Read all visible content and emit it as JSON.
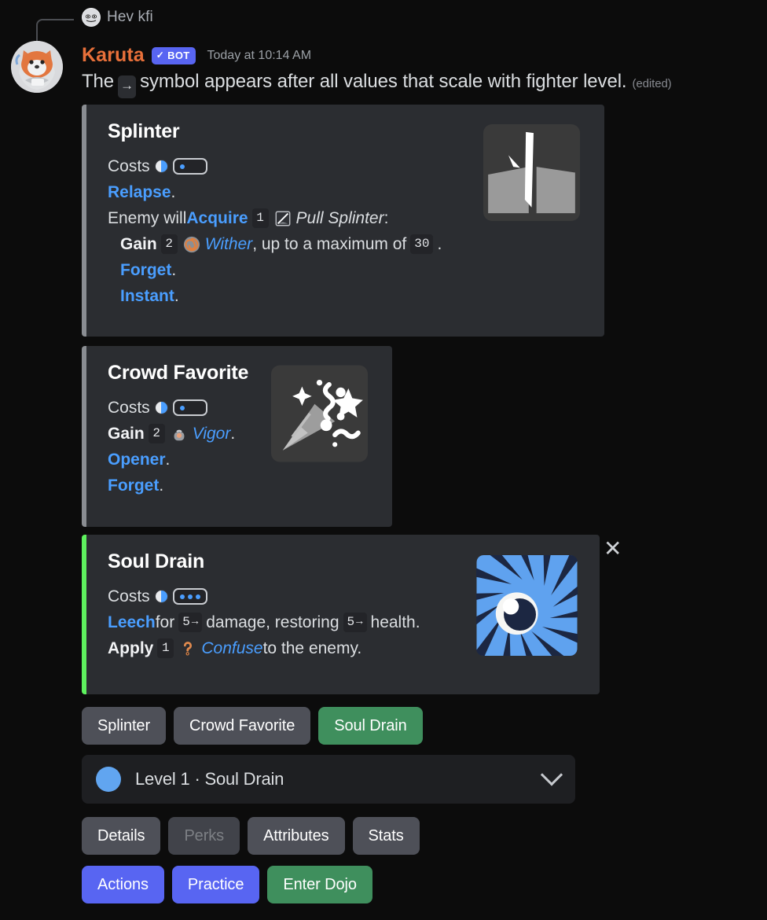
{
  "reply": {
    "author": "Hev kfi",
    "avatar_icon": "user-avatar-small"
  },
  "message": {
    "author": "Karuta",
    "bot_badge": "BOT",
    "bot_check": "✓",
    "timestamp": "Today at 10:14 AM",
    "text_before": "The",
    "scale_symbol": "→",
    "text_after": "symbol appears after all values that scale with fighter level.",
    "edited": "(edited)"
  },
  "embeds": [
    {
      "title": "Splinter",
      "bar_color": "#8a8d92",
      "thumb_icon": "cracked-ground-icon",
      "cost_label": "Costs",
      "cost_pips": 1,
      "lines": [
        [
          {
            "t": "kw",
            "v": "Relapse"
          },
          {
            "t": "txt",
            "v": "."
          }
        ],
        [
          {
            "t": "txt",
            "v": "Enemy will "
          },
          {
            "t": "kw",
            "v": "Acquire"
          },
          {
            "t": "chip",
            "v": "1"
          },
          {
            "t": "emoji",
            "v": "pull-splinter-icon"
          },
          {
            "t": "it",
            "v": "Pull Splinter"
          },
          {
            "t": "txt",
            "v": ":"
          }
        ],
        [
          {
            "t": "bold",
            "v": "Gain"
          },
          {
            "t": "chip",
            "v": "2"
          },
          {
            "t": "emoji",
            "v": "wither-icon"
          },
          {
            "t": "kwit",
            "v": "Wither"
          },
          {
            "t": "txt",
            "v": ", up to a maximum of "
          },
          {
            "t": "chip",
            "v": "30"
          },
          {
            "t": "txt",
            "v": "."
          }
        ],
        [
          {
            "t": "kw",
            "v": "Forget"
          },
          {
            "t": "txt",
            "v": "."
          }
        ],
        [
          {
            "t": "kw",
            "v": "Instant"
          },
          {
            "t": "txt",
            "v": "."
          }
        ]
      ],
      "indent_from": 2
    },
    {
      "title": "Crowd Favorite",
      "bar_color": "#8a8d92",
      "thumb_icon": "party-popper-icon",
      "cost_label": "Costs",
      "cost_pips": 1,
      "lines": [
        [
          {
            "t": "bold",
            "v": "Gain"
          },
          {
            "t": "chip",
            "v": "2"
          },
          {
            "t": "emoji",
            "v": "vigor-icon"
          },
          {
            "t": "kwit",
            "v": "Vigor"
          },
          {
            "t": "txt",
            "v": "."
          }
        ],
        [
          {
            "t": "kw",
            "v": "Opener"
          },
          {
            "t": "txt",
            "v": "."
          }
        ],
        [
          {
            "t": "kw",
            "v": "Forget"
          },
          {
            "t": "txt",
            "v": "."
          }
        ]
      ],
      "indent_from": 99
    },
    {
      "title": "Soul Drain",
      "bar_color": "#5ef25e",
      "thumb_icon": "hypnotic-eye-icon",
      "cost_label": "Costs",
      "cost_pips": 3,
      "close_label": "✕",
      "lines": [
        [
          {
            "t": "kw",
            "v": "Leech"
          },
          {
            "t": "txt",
            "v": " for "
          },
          {
            "t": "chipscale",
            "v": "5"
          },
          {
            "t": "txt",
            "v": " damage, restoring "
          },
          {
            "t": "chipscale",
            "v": "5"
          },
          {
            "t": "txt",
            "v": " health."
          }
        ],
        [
          {
            "t": "bold",
            "v": "Apply"
          },
          {
            "t": "chip",
            "v": "1"
          },
          {
            "t": "emoji",
            "v": "confuse-icon"
          },
          {
            "t": "kwit",
            "v": "Confuse"
          },
          {
            "t": "txt",
            "v": " to the enemy."
          }
        ]
      ],
      "indent_from": 99
    }
  ],
  "card_buttons": [
    {
      "label": "Splinter",
      "style": "grey"
    },
    {
      "label": "Crowd Favorite",
      "style": "grey"
    },
    {
      "label": "Soul Drain",
      "style": "green"
    }
  ],
  "select": {
    "label": "Level 1 · Soul Drain",
    "orb_color": "#61a5f0",
    "chevron_icon": "chevron-down-icon"
  },
  "tab_buttons": [
    {
      "label": "Details",
      "style": "grey"
    },
    {
      "label": "Perks",
      "style": "disabled"
    },
    {
      "label": "Attributes",
      "style": "grey"
    },
    {
      "label": "Stats",
      "style": "grey"
    }
  ],
  "action_buttons": [
    {
      "label": "Actions",
      "style": "blurple"
    },
    {
      "label": "Practice",
      "style": "blurple"
    },
    {
      "label": "Enter Dojo",
      "style": "green"
    }
  ]
}
